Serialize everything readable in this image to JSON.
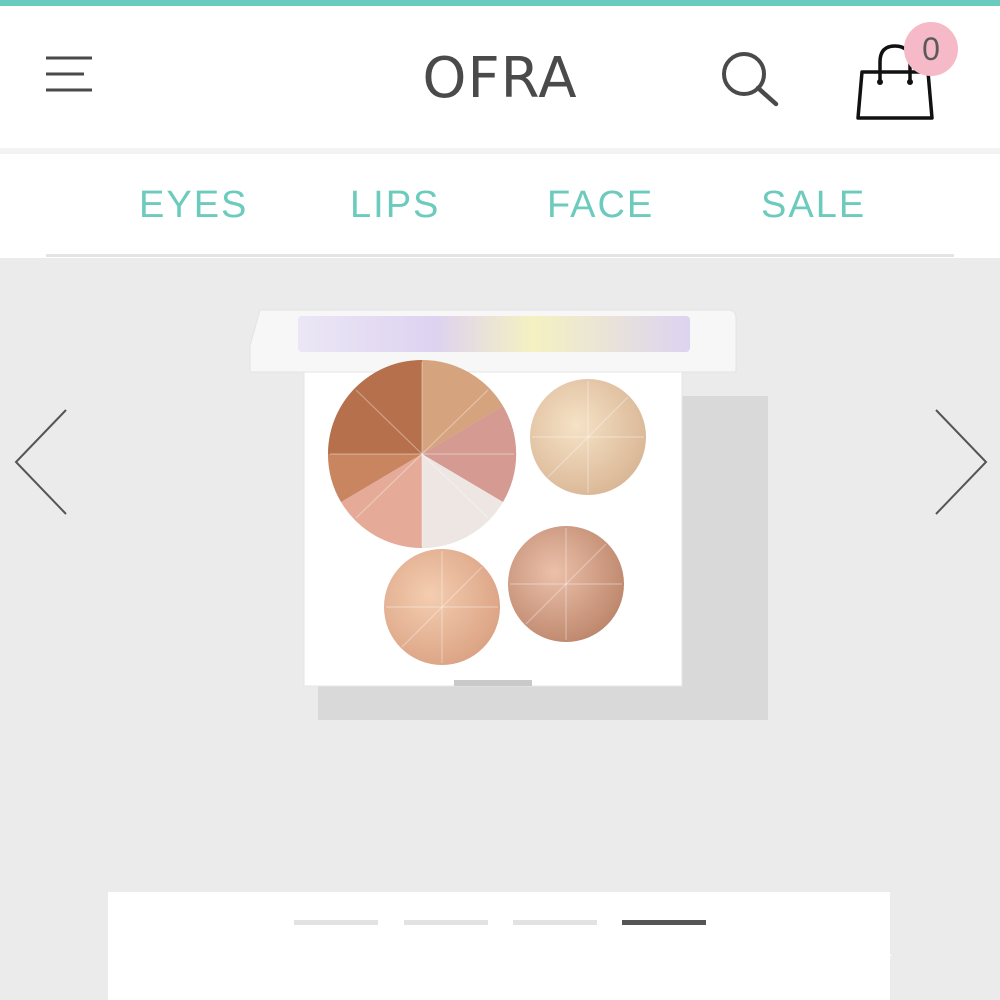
{
  "header": {
    "brand": "OFRA",
    "cart_count": "0",
    "icons": {
      "menu": "hamburger-menu-icon",
      "search": "search-icon",
      "cart": "shopping-bag-icon"
    }
  },
  "nav": {
    "items": [
      {
        "label": "EYES"
      },
      {
        "label": "LIPS"
      },
      {
        "label": "FACE"
      },
      {
        "label": "SALE"
      }
    ]
  },
  "carousel": {
    "slide_count": 4,
    "active_index": 3,
    "prev_icon": "chevron-left-icon",
    "next_icon": "chevron-right-icon"
  },
  "colors": {
    "accent": "#6ccbbd",
    "topbar": "#68cbbd",
    "badge": "#f6b9c7",
    "text_dark": "#4a4a4a",
    "hero_bg": "#ebebeb"
  }
}
